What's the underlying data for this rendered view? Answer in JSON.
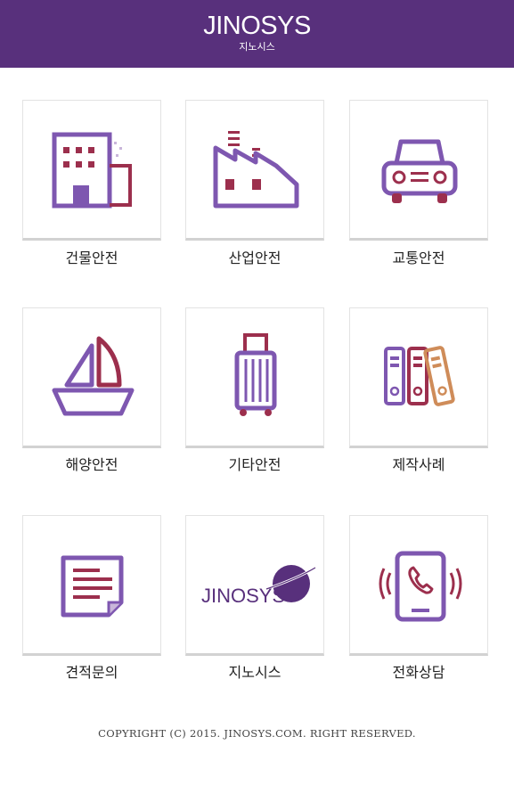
{
  "header": {
    "brand": "JINOSYS",
    "brand_sub": "지노시스"
  },
  "menu": [
    {
      "label": "건물안전",
      "icon": "building-icon"
    },
    {
      "label": "산업안전",
      "icon": "factory-icon"
    },
    {
      "label": "교통안전",
      "icon": "car-icon"
    },
    {
      "label": "해양안전",
      "icon": "sailboat-icon"
    },
    {
      "label": "기타안전",
      "icon": "suitcase-icon"
    },
    {
      "label": "제작사례",
      "icon": "binders-icon"
    },
    {
      "label": "견적문의",
      "icon": "document-icon"
    },
    {
      "label": "지노시스",
      "icon": "jinosys-logo",
      "logo_text": "JINOSYS"
    },
    {
      "label": "전화상담",
      "icon": "phone-ringing-icon"
    }
  ],
  "footer": {
    "copyright": "COPYRIGHT (C) 2015. JINOSYS.COM. RIGHT RESERVED."
  },
  "colors": {
    "header": "#58307c",
    "purple": "#7e57b0",
    "crimson": "#9c2f4d",
    "orange": "#cf8c59"
  }
}
